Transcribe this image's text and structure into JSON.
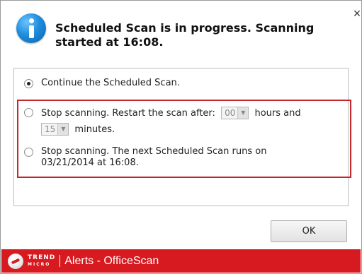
{
  "dialog": {
    "title": "Scheduled Scan is in progress. Scanning started at 16:08.",
    "close_symbol": "×",
    "icon": "info-icon"
  },
  "options": {
    "continue_label": "Continue the Scheduled Scan.",
    "restart_label_before": "Stop scanning. Restart the scan after:",
    "hours_value": "00",
    "hours_label": "hours and",
    "minutes_value": "15",
    "minutes_label": "minutes.",
    "next_scan_label": "Stop scanning. The next Scheduled Scan runs on 03/21/2014 at 16:08.",
    "selected": "continue"
  },
  "buttons": {
    "ok_label": "OK"
  },
  "footer": {
    "brand_line1": "TREND",
    "brand_line2": "MICRO",
    "title": "Alerts - OfficeScan"
  },
  "colors": {
    "footer_bg": "#d71920",
    "highlight_border": "#c1272d",
    "info_icon": "#1f8ddc"
  }
}
